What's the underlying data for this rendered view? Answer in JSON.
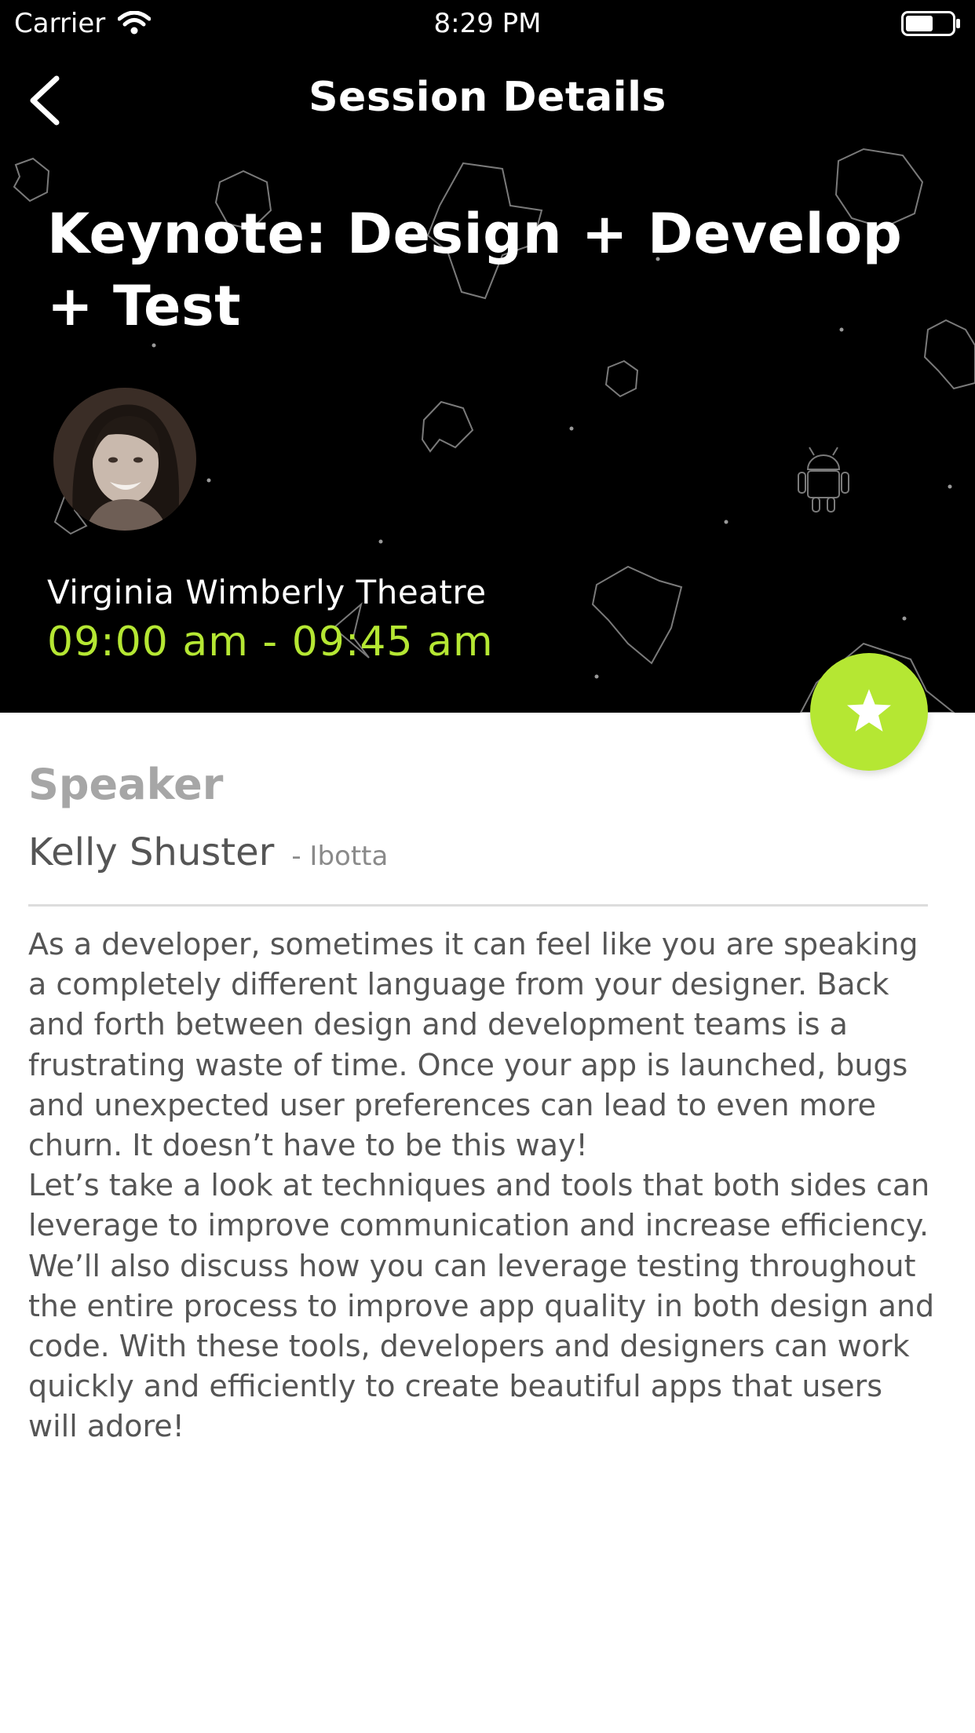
{
  "status_bar": {
    "carrier": "Carrier",
    "time": "8:29 PM"
  },
  "nav": {
    "title": "Session Details",
    "back_icon": "chevron-left-icon"
  },
  "session": {
    "title": "Keynote: Design + Develop + Test",
    "venue": "Virginia Wimberly Theatre",
    "time": "09:00 am - 09:45 am"
  },
  "favorite": {
    "icon": "star-icon"
  },
  "speaker_section": {
    "heading": "Speaker",
    "name": "Kelly Shuster",
    "company": "- Ibotta"
  },
  "description": {
    "paragraphs": [
      "As a developer, sometimes it can feel like you are speaking a completely different language from your designer. Back and forth between design and development teams is a frustrating waste of time. Once your app is launched, bugs and unexpected user preferences can lead to even more churn. It doesn’t have to be this way!",
      "Let’s take a look at techniques and tools that both sides can leverage to improve communication and increase efficiency. We’ll also discuss how you can leverage testing throughout the entire process to improve app quality in both design and code. With these tools, developers and designers can work quickly and efficiently to create beautiful apps that users will adore!"
    ]
  },
  "colors": {
    "accent": "#b5e733",
    "hero_background": "#000000",
    "heading_gray": "#a6a6a6",
    "text_gray": "#555555"
  }
}
